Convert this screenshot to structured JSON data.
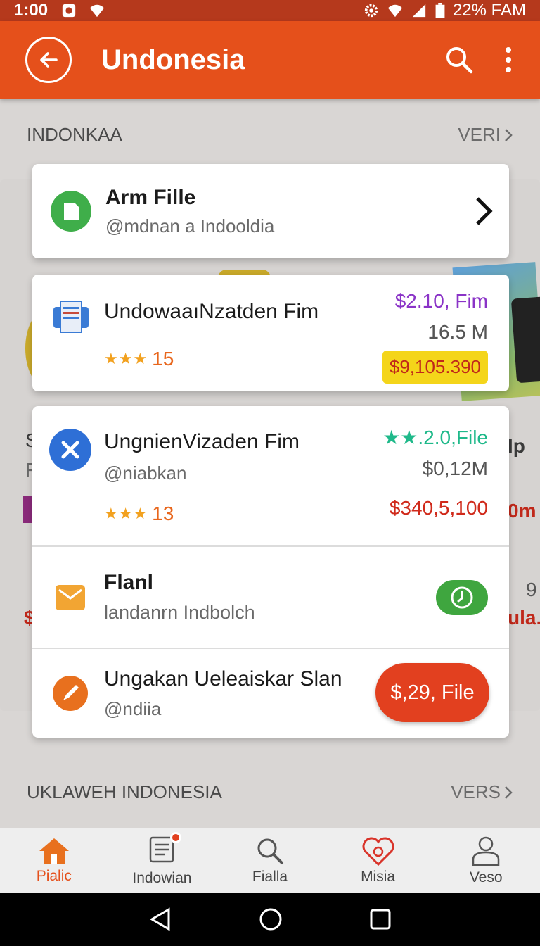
{
  "status_bar": {
    "time": "1:00",
    "battery_text": "22% FAM"
  },
  "app_bar": {
    "title": "Undonesia"
  },
  "sections": [
    {
      "title": "INDONKAA",
      "more": "VERI"
    },
    {
      "title": "UKLAWEH INDONESIA",
      "more": "VERS"
    }
  ],
  "background_fragments": [
    "S",
    "F",
    "lp",
    "0m",
    "9",
    "ula.",
    "$"
  ],
  "cards": [
    {
      "title": "Arm Fille",
      "subtitle": "@mdnan a Indooldia",
      "icon": "file-icon",
      "icon_color": "#3fae4a"
    },
    {
      "title": "UndowaaıNzatden Fim",
      "price": "$2.10, Fim",
      "size": "16.5 M",
      "rating": "15",
      "badge": "$9,105.390",
      "icon": "document-icon",
      "price_color": "#8a33c7",
      "badge_color": "#f4d51a"
    },
    {
      "title": "UngnienVizaden Fim",
      "subtitle": "@niabkan",
      "price": "★★.2.0,File",
      "size": "$0,12M",
      "rating": "13",
      "amount": "$340,5,100",
      "icon": "close-icon",
      "price_color": "#1fb98a",
      "amount_color": "#d02a1b"
    },
    {
      "title": "Flanl",
      "subtitle": "landanrn Indbolch",
      "icon": "mail-icon",
      "toggle_color": "#3fa63f"
    },
    {
      "title": "Ungakan Ueleaiskar Slan",
      "subtitle": "@ndiia",
      "button": "$,29, File",
      "icon": "pen-icon",
      "button_color": "#e2401f"
    }
  ],
  "bottom_nav": [
    {
      "label": "Pialic",
      "icon": "home-icon",
      "active": true
    },
    {
      "label": "Indowian",
      "icon": "notes-icon",
      "active": false
    },
    {
      "label": "Fialla",
      "icon": "search-icon",
      "active": false
    },
    {
      "label": "Misia",
      "icon": "heart-icon",
      "active": false
    },
    {
      "label": "Veso",
      "icon": "profile-icon",
      "active": false
    }
  ],
  "colors": {
    "primary": "#e5501b",
    "status_bar": "#b5391c"
  }
}
